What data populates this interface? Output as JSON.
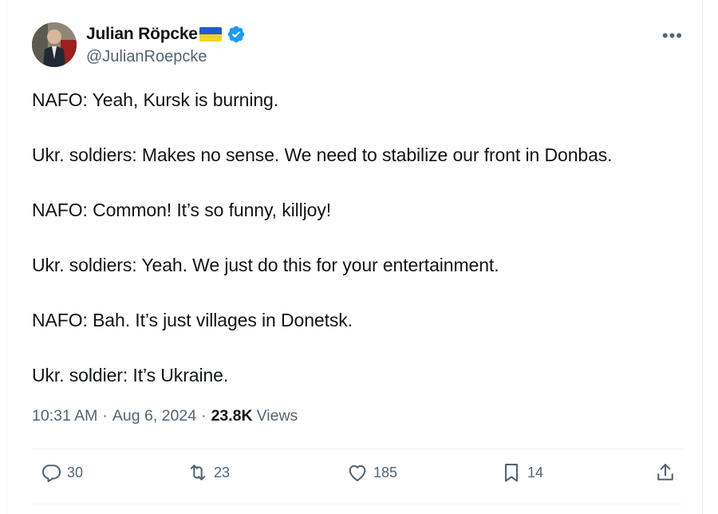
{
  "author": {
    "name": "Julian Röpcke",
    "handle": "@JulianRoepcke",
    "verified": true,
    "flag": "ukraine-flag"
  },
  "tweet": {
    "lines": [
      "NAFO: Yeah, Kursk is burning.",
      "Ukr. soldiers: Makes no sense. We need to stabilize our front in Donbas.",
      "NAFO: Common! It’s so funny, killjoy!",
      "Ukr. soldiers: Yeah. We just do this for your entertainment.",
      "NAFO: Bah. It’s just villages in Donetsk.",
      "Ukr. soldier: It’s Ukraine."
    ]
  },
  "meta": {
    "time": "10:31 AM",
    "date": "Aug 6, 2024",
    "separator": "·",
    "views_count": "23.8K",
    "views_label": "Views"
  },
  "actions": {
    "replies": "30",
    "reposts": "23",
    "likes": "185",
    "bookmarks": "14"
  },
  "colors": {
    "text": "#0f1419",
    "secondary": "#536471",
    "verified_blue": "#1d9bf0",
    "divider": "#eff3f4"
  }
}
